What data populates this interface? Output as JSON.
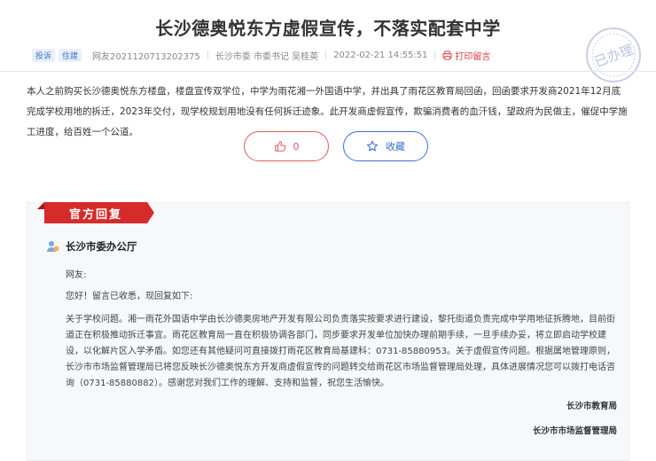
{
  "title": "长沙德奥悦东方虚假宣传，不落实配套中学",
  "meta": {
    "tags": [
      "投诉",
      "住建"
    ],
    "user": "网友2021120713202375",
    "target": "长沙市委 市委书记 吴桂英",
    "datetime": "2022-02-21 14:55:51",
    "print_label": "打印留言"
  },
  "stamp_text": "已办理",
  "complaint_text": "本人之前购买长沙德奥悦东方楼盘，楼盘宣传双学位，中学为雨花湘一外国语中学，并出具了雨花区教育局回函，回函要求开发商2021年12月底完成学校用地的拆迁，2023年交付，现学校规划用地没有任何拆迁迹象。此开发商虚假宣传，欺骗消费者的血汗钱，望政府为民做主，催促中学施工进度，给百姓一个公道。",
  "actions": {
    "like_count": "0",
    "favorite_label": "收藏"
  },
  "reply": {
    "section_title": "官方回复",
    "org": "长沙市委办公厅",
    "greeting": "网友:",
    "hello": "您好！留言已收悉，现回复如下:",
    "content": "关于学校问题。湘一雨花外国语中学由长沙德奥房地产开发有限公司负责落实按要求进行建设，黎托街道负责完成中学用地征拆腾地，目前街道正在积极推动拆迁事宜。雨花区教育局一直在积极协调各部门，同步要求开发单位加快办理前期手续，一旦手续办妥，将立即启动学校建设，以化解片区入学矛盾。如您还有其他疑问可直接拨打雨花区教育局基建科：0731-85880953。关于虚假宣传问题。根据属地管理原则，长沙市市场监督管理局已将您反映长沙德奥悦东方开发商虚假宣传的问题转交给雨花区市场监督管理局处理，具体进展情况您可以拨打电话咨询（0731-85880882）。感谢您对我们工作的理解、支持和监督，祝您生活愉快。",
    "signatures": [
      "长沙市教育局",
      "长沙市市场监督管理局"
    ]
  }
}
